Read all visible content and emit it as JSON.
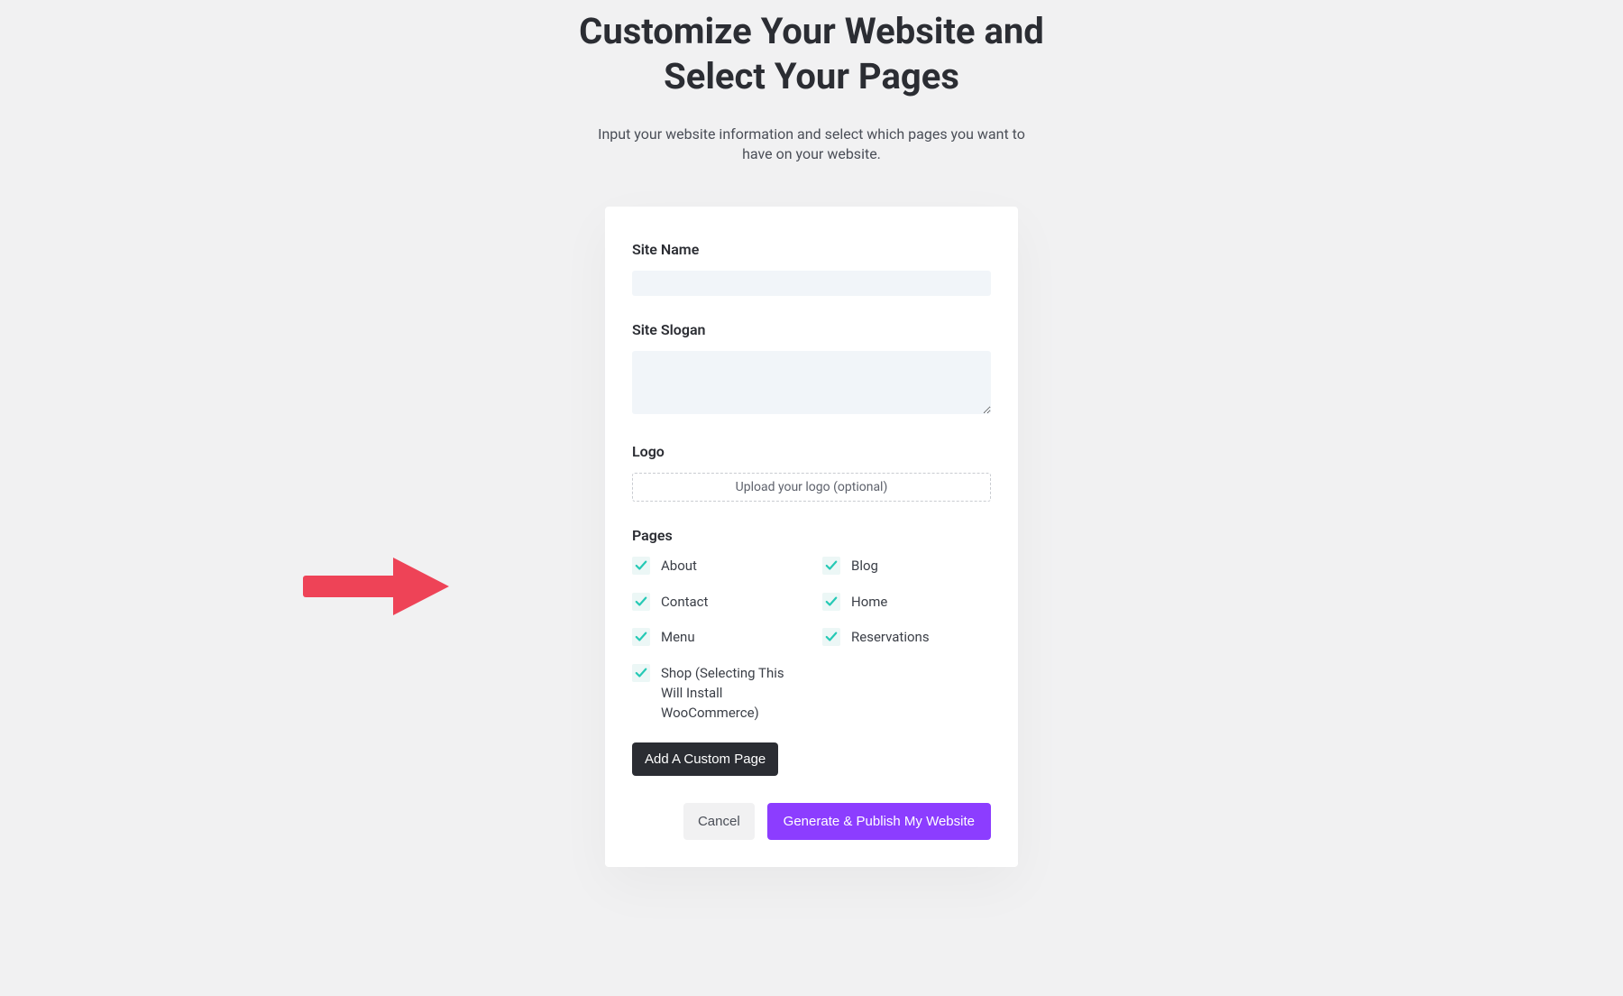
{
  "header": {
    "title": "Customize Your Website and Select Your Pages",
    "subtitle": "Input your website information and select which pages you want to have on your website."
  },
  "form": {
    "site_name": {
      "label": "Site Name",
      "value": ""
    },
    "site_slogan": {
      "label": "Site Slogan",
      "value": ""
    },
    "logo": {
      "label": "Logo",
      "upload_text": "Upload your logo (optional)"
    },
    "pages": {
      "label": "Pages",
      "items": [
        {
          "label": "About",
          "checked": true
        },
        {
          "label": "Blog",
          "checked": true
        },
        {
          "label": "Contact",
          "checked": true
        },
        {
          "label": "Home",
          "checked": true
        },
        {
          "label": "Menu",
          "checked": true
        },
        {
          "label": "Reservations",
          "checked": true
        },
        {
          "label": "Shop (Selecting This Will Install WooCommerce)",
          "checked": true
        }
      ],
      "add_button": "Add A Custom Page"
    }
  },
  "actions": {
    "cancel": "Cancel",
    "generate": "Generate & Publish My Website"
  },
  "colors": {
    "primary": "#8c3dff",
    "check": "#25c9b5",
    "arrow": "#ee4357"
  }
}
